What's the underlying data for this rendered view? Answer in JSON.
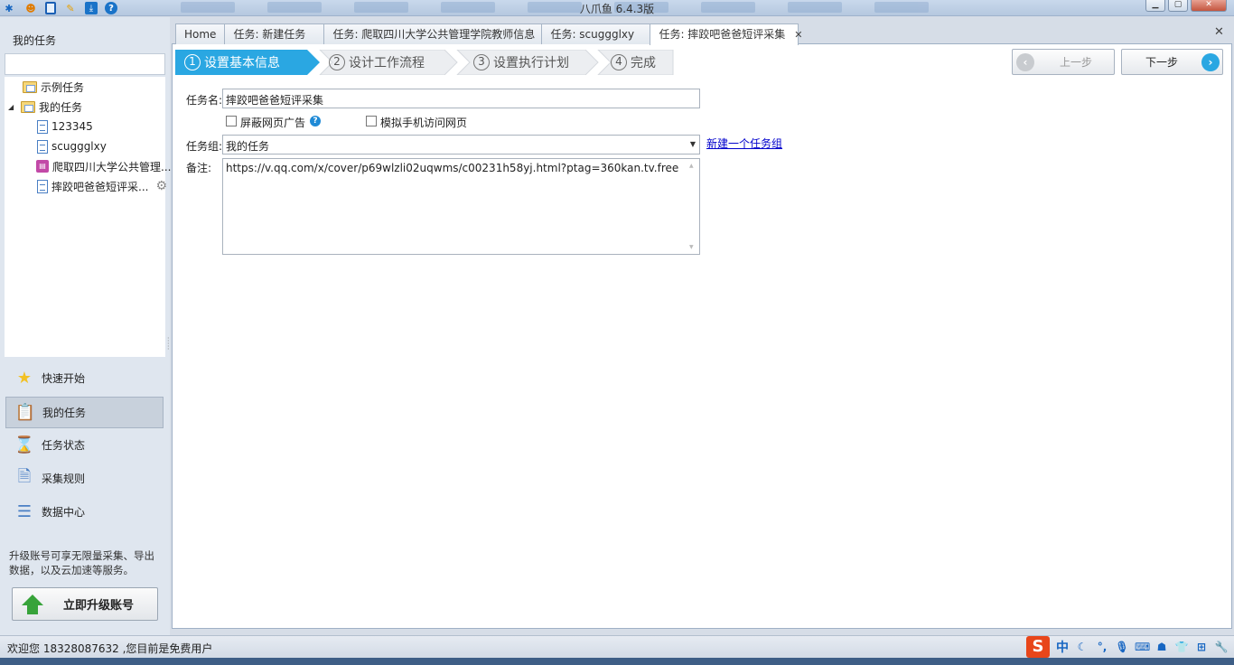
{
  "window": {
    "title": "八爪鱼 6.4.3版"
  },
  "sidebar": {
    "title": "我的任务",
    "tree": [
      {
        "label": "示例任务",
        "type": "folder"
      },
      {
        "label": "我的任务",
        "type": "folder",
        "expanded": true
      },
      {
        "label": "123345",
        "type": "doc"
      },
      {
        "label": "scuggglxy",
        "type": "doc"
      },
      {
        "label": "爬取四川大学公共管理...",
        "type": "doc-pink"
      },
      {
        "label": "摔跤吧爸爸短评采...",
        "type": "doc",
        "icon": "gear-icon"
      }
    ],
    "nav": [
      {
        "label": "快速开始",
        "icon": "star-icon"
      },
      {
        "label": "我的任务",
        "icon": "clipboard-icon",
        "active": true
      },
      {
        "label": "任务状态",
        "icon": "hourglass-icon"
      },
      {
        "label": "采集规则",
        "icon": "document-icon"
      },
      {
        "label": "数据中心",
        "icon": "database-icon"
      }
    ],
    "upgrade_text": "升级账号可享无限量采集、导出数据，以及云加速等服务。",
    "upgrade_button": "立即升级账号"
  },
  "tabs": [
    {
      "label": "Home"
    },
    {
      "label": "任务: 新建任务"
    },
    {
      "label": "任务: 爬取四川大学公共管理学院教师信息"
    },
    {
      "label": "任务: scuggglxy"
    },
    {
      "label": "任务: 摔跤吧爸爸短评采集",
      "active": true
    }
  ],
  "wizard": {
    "steps": [
      {
        "num": "1",
        "label": "设置基本信息",
        "active": true
      },
      {
        "num": "2",
        "label": "设计工作流程"
      },
      {
        "num": "3",
        "label": "设置执行计划"
      },
      {
        "num": "4",
        "label": "完成"
      }
    ],
    "prev_label": "上一步",
    "next_label": "下一步"
  },
  "form": {
    "name_label": "任务名:",
    "name_value": "摔跤吧爸爸短评采集",
    "block_ads_label": "屏蔽网页广告",
    "mobile_label": "模拟手机访问网页",
    "group_label": "任务组:",
    "group_value": "我的任务",
    "new_group_link": "新建一个任务组",
    "notes_label": "备注:",
    "notes_value": "https://v.qq.com/x/cover/p69wlzli02uqwms/c00231h58yj.html?ptag=360kan.tv.free"
  },
  "status": {
    "text": "欢迎您  18328087632 ,您目前是免费用户"
  },
  "tray": {
    "ime": "中"
  },
  "colors": {
    "accent": "#2aa7e2",
    "link": "#0000cc",
    "upgrade_green": "#37a33a"
  }
}
